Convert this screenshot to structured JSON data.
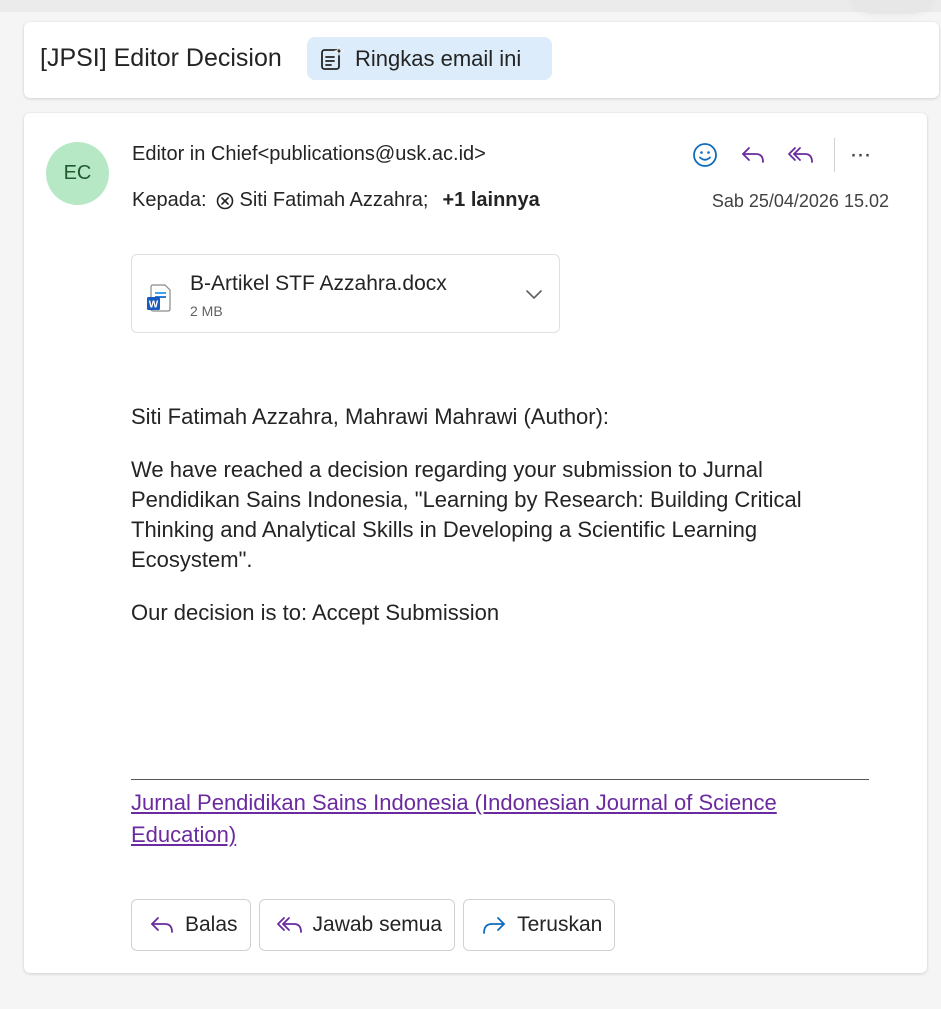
{
  "subject": {
    "title": "[JPSI] Editor Decision",
    "summarize_label": "Ringkas email ini"
  },
  "message": {
    "avatar_initials": "EC",
    "sender": "Editor in Chief<publications@usk.ac.id>",
    "to_label": "Kepada:",
    "recipient": "Siti Fatimah Azzahra;",
    "more_recipients": "+1 lainnya",
    "date": "Sab 25/04/2026 15.02",
    "attachment": {
      "name": "B-Artikel STF Azzahra.docx",
      "size": "2 MB"
    },
    "body": {
      "greeting": "Siti Fatimah Azzahra, Mahrawi Mahrawi (Author):",
      "paragraph1": "We have reached a decision regarding your submission to Jurnal Pendidikan Sains Indonesia, \"Learning by Research: Building Critical Thinking and Analytical Skills in Developing a Scientific Learning Ecosystem\".",
      "paragraph2": "Our decision is to: Accept Submission"
    },
    "signature_link": "Jurnal Pendidikan Sains Indonesia (Indonesian Journal of Science Education)",
    "more_actions": "···"
  },
  "footer_buttons": {
    "reply": "Balas",
    "reply_all": "Jawab semua",
    "forward": "Teruskan"
  },
  "icons": {
    "summarize": "summarize-sparkle-icon",
    "remove_recipient": "circle-x-icon",
    "emoji": "smiley-icon",
    "reply": "reply-arrow-icon",
    "reply_all": "reply-all-arrow-icon",
    "word_doc": "word-doc-icon",
    "expand": "chevron-down-icon",
    "forward": "forward-arrow-icon"
  },
  "colors": {
    "accent_purple": "#6b2ba0",
    "accent_blue": "#0f6cbd",
    "avatar_bg": "#b7e8c6",
    "summarize_bg": "#dcecfa"
  }
}
